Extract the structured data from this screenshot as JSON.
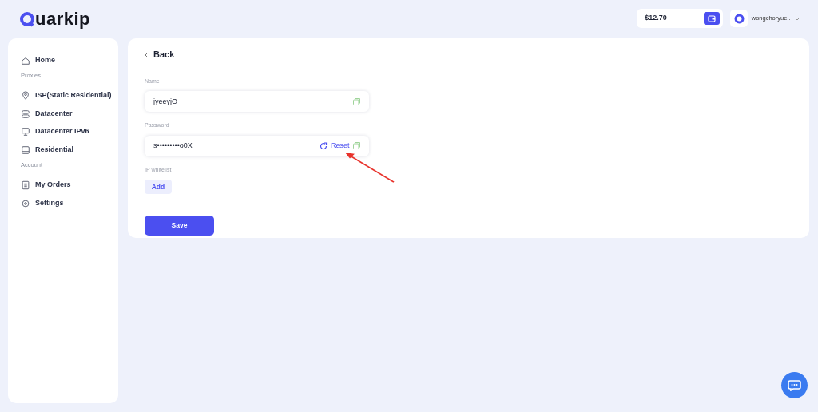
{
  "logo": {
    "text": "uarkip"
  },
  "header": {
    "balance": "$12.70",
    "username": "wongchoryue.."
  },
  "sidebar": {
    "items": [
      {
        "kind": "link",
        "label": "Home"
      },
      {
        "kind": "section",
        "label": "Proxies"
      },
      {
        "kind": "link",
        "label": "ISP(Static Residential)"
      },
      {
        "kind": "link",
        "label": "Datacenter"
      },
      {
        "kind": "link",
        "label": "Datacenter IPv6"
      },
      {
        "kind": "link",
        "label": "Residential"
      },
      {
        "kind": "section",
        "label": "Account"
      },
      {
        "kind": "link",
        "label": "My Orders"
      },
      {
        "kind": "link",
        "label": "Settings"
      }
    ]
  },
  "form": {
    "back": "Back",
    "name": {
      "label": "Name",
      "value": "jyeeyjO"
    },
    "password": {
      "label": "Password",
      "value": "s•••••••••o0X",
      "reset": "Reset"
    },
    "whitelist": {
      "label": "IP whitelist",
      "add": "Add"
    },
    "save": "Save"
  },
  "annotation_arrow": {
    "color": "#e8322b"
  }
}
